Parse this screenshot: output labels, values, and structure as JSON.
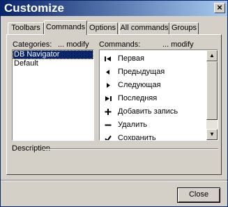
{
  "window": {
    "title": "Customize",
    "close_glyph": "×"
  },
  "tabs": [
    {
      "label": "Toolbars",
      "active": false
    },
    {
      "label": "Commands",
      "active": true
    },
    {
      "label": "Options",
      "active": false
    },
    {
      "label": "All commands",
      "active": false
    },
    {
      "label": "Groups",
      "active": false
    }
  ],
  "categories": {
    "label": "Categories:",
    "modify": "... modify",
    "items": [
      {
        "label": "DB Navigator",
        "selected": true
      },
      {
        "label": "Default",
        "selected": false
      }
    ]
  },
  "commands": {
    "label": "Commands:",
    "modify": "... modify",
    "items": [
      {
        "label": "Первая",
        "icon": "first-record-icon"
      },
      {
        "label": "Предыдущая",
        "icon": "prior-record-icon"
      },
      {
        "label": "Следующая",
        "icon": "next-record-icon"
      },
      {
        "label": "Последняя",
        "icon": "last-record-icon"
      },
      {
        "label": "Добавить запись",
        "icon": "insert-record-icon"
      },
      {
        "label": "Удалить",
        "icon": "delete-record-icon"
      },
      {
        "label": "Сохранить",
        "icon": "post-record-icon"
      }
    ]
  },
  "description": {
    "label": "Description"
  },
  "footer": {
    "close_label": "Close"
  },
  "colors": {
    "title_bar_start": "#0a246a",
    "title_bar_end": "#a6caf0",
    "selection": "#0a246a",
    "face": "#d4d0c8"
  }
}
